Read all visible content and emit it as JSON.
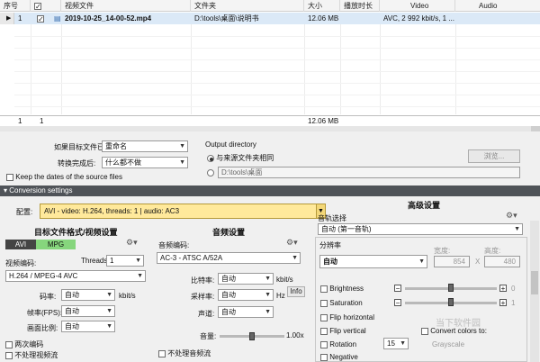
{
  "grid": {
    "headers": [
      "序号",
      "视频文件",
      "文件夹",
      "大小",
      "播放时长",
      "Video",
      "Audio"
    ],
    "row": {
      "index": "1",
      "file": "2019-10-25_14-00-52.mp4",
      "folder": "D:\\tools\\桌面\\说明书",
      "size": "12.06 MB",
      "duration": "",
      "video": "AVC, 2 992 kbit/s, 1 ..."
    },
    "summary": {
      "count1": "1",
      "count2": "1",
      "size": "12.06 MB"
    }
  },
  "options": {
    "exists_label": "如果目标文件已存在:",
    "exists_value": "重命名",
    "after_label": "转换完成后:",
    "after_value": "什么都不做",
    "keep_dates": "Keep the dates of the source files",
    "output_dir_label": "Output directory",
    "same_as_source": "与来源文件夹相同",
    "custom_path": "D:\\tools\\桌面",
    "browse": "浏览..."
  },
  "conversion": {
    "bar_title": "Conversion settings",
    "profile_label": "配置:",
    "profile_value": "AVI - video: H.264, threads: 1 | audio: AC3"
  },
  "video": {
    "title": "目标文件格式/视频设置",
    "tab_avi": "AVI",
    "tab_mpg": "MPG",
    "codec_label": "视频编码:",
    "threads_label": "Threads:",
    "threads_value": "1",
    "codec_value": "H.264 / MPEG-4 AVC",
    "bitrate_label": "码率:",
    "bitrate_value": "自动",
    "bitrate_unit": "kbit/s",
    "fps_label": "帧率(FPS):",
    "fps_value": "自动",
    "aspect_label": "画面比例:",
    "aspect_value": "自动",
    "two_pass": "两次编码",
    "no_video": "不处理视频流"
  },
  "audio": {
    "title": "音频设置",
    "codec_label": "音频编码:",
    "codec_value": "AC-3 - ATSC A/52A",
    "bitrate_label": "比特率:",
    "bitrate_value": "自动",
    "bitrate_unit": "kbit/s",
    "samplerate_label": "采样率:",
    "samplerate_value": "自动",
    "samplerate_unit": "Hz",
    "info": "Info",
    "channels_label": "声道:",
    "channels_value": "自动",
    "volume_label": "音量:",
    "volume_value": "1.00x",
    "volume_level": 1.0,
    "no_audio": "不处理音频流"
  },
  "advanced": {
    "title": "高级设置",
    "track_label": "音轨选择",
    "track_value": "自动 (第一音轨)",
    "resolution_label": "分辨率",
    "resolution_value": "自动",
    "width_label": "宽度:",
    "width_value": "854",
    "height_label": "高度:",
    "height_value": "480",
    "x": "X",
    "brightness": "Brightness",
    "brightness_value": "0",
    "saturation": "Saturation",
    "saturation_value": "1",
    "flip_h": "Flip horizontal",
    "flip_v": "Flip vertical",
    "rotation": "Rotation",
    "rotation_value": "15",
    "negative": "Negative",
    "convert_colors": "Convert colors to:",
    "grayscale": "Grayscale"
  },
  "watermark": "当下软件园"
}
